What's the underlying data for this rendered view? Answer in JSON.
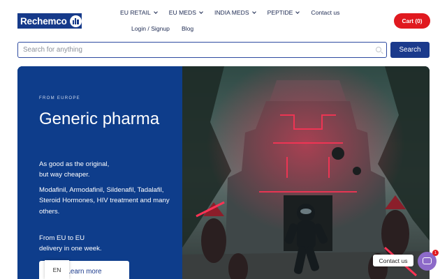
{
  "brand": {
    "logo_text": "Rechemco"
  },
  "nav": {
    "row1": [
      {
        "label": "EU RETAIL",
        "dropdown": true
      },
      {
        "label": "EU MEDS",
        "dropdown": true
      },
      {
        "label": "INDIA MEDS",
        "dropdown": true
      },
      {
        "label": "PEPTIDE",
        "dropdown": true
      },
      {
        "label": "Contact us",
        "dropdown": false
      }
    ],
    "row2": [
      {
        "label": "Login / Signup"
      },
      {
        "label": "Blog"
      }
    ]
  },
  "cart": {
    "label": "Cart (0)"
  },
  "search": {
    "placeholder": "Search for anything",
    "button_label": "Search"
  },
  "hero": {
    "eyebrow": "FROM EUROPE",
    "headline": "Generic pharma",
    "subtitle_line1": "As good as the original,",
    "subtitle_line2": "but way cheaper.",
    "products": "Modafinil, Armodafinil, Sildenafil, Tadalafil, Steroid Hormones, HIV treatment and many others.",
    "delivery_line1": "From EU to EU",
    "delivery_line2": "delivery in one week.",
    "cta_label": "Learn more"
  },
  "language": {
    "current": "EN"
  },
  "contact_widget": {
    "label": "Contact us",
    "badge_count": "1"
  },
  "colors": {
    "brand_blue": "#0e3d8b",
    "cart_red": "#e0191f",
    "contact_purple": "#8d6ac9"
  }
}
